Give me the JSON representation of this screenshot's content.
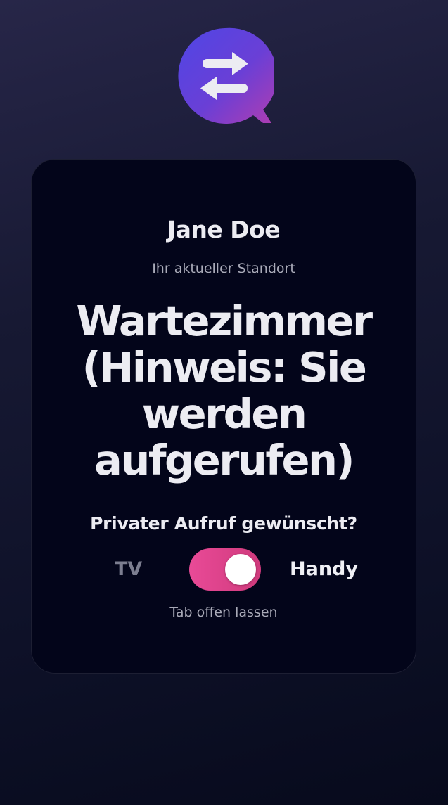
{
  "logo": {
    "icon": "swap-arrows-chat-icon",
    "gradient": [
      "#4f46e5",
      "#a23bb8"
    ]
  },
  "card": {
    "user_name": "Jane Doe",
    "location_label": "Ihr aktueller Standort",
    "location": "Wartezimmer (Hinweis: Sie werden aufgerufen)",
    "private_call_question": "Privater Aufruf gewünscht?",
    "toggle": {
      "left_option": "TV",
      "right_option": "Handy",
      "selected": "Handy",
      "on": true,
      "active_color": "#e94a97"
    },
    "hint": "Tab offen lassen"
  }
}
